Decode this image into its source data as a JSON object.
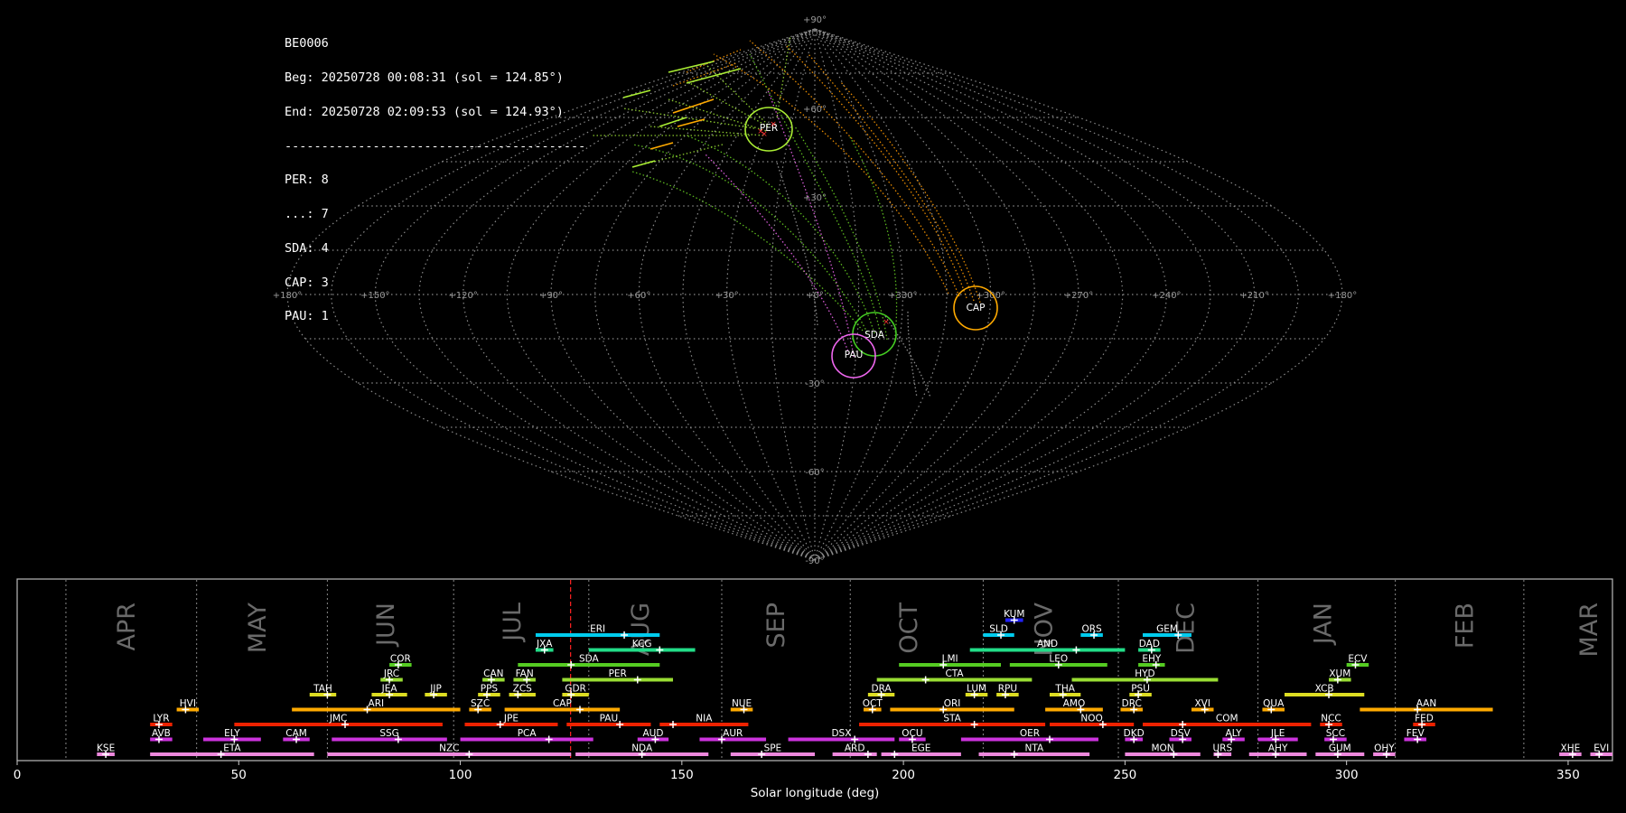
{
  "info": {
    "station": "BE0006",
    "begin": "Beg: 20250728 00:08:31 (sol = 124.85°)",
    "end": "End: 20250728 02:09:53 (sol = 124.93°)",
    "separator": "-----------------------------------------",
    "counts": [
      {
        "label": "PER: 8"
      },
      {
        "label": "...: 7"
      },
      {
        "label": "SDA: 4"
      },
      {
        "label": "CAP: 3"
      },
      {
        "label": "PAU: 1"
      }
    ]
  },
  "sky_map": {
    "lon_labels": [
      "+180°",
      "+150°",
      "+120°",
      "+90°",
      "+60°",
      "+30°",
      "+0°",
      "+330°",
      "+300°",
      "+270°",
      "+240°",
      "+210°",
      "+180°"
    ],
    "lat_labels": [
      "+90°",
      "+60°",
      "+30°",
      "+0°",
      "-30°",
      "-60°",
      "-90°"
    ],
    "showers": [
      {
        "code": "PER",
        "color": "#aaee33"
      },
      {
        "code": "CAP",
        "color": "#ffaa00"
      },
      {
        "code": "SDA",
        "color": "#44cc22"
      },
      {
        "code": "PAU",
        "color": "#ee66ee"
      }
    ]
  },
  "chart_data": {
    "type": "timeline",
    "xlabel": "Solar longitude (deg)",
    "xlim": [
      0,
      360
    ],
    "x_ticks": [
      0,
      50,
      100,
      150,
      200,
      250,
      300,
      350
    ],
    "current_sol": 124.89,
    "month_boundaries": [
      11,
      40.5,
      70,
      98.5,
      129,
      159,
      188,
      218,
      248.5,
      280,
      311,
      340
    ],
    "months": [
      {
        "label": "APR",
        "sol": 25
      },
      {
        "label": "MAY",
        "sol": 54.5
      },
      {
        "label": "JUN",
        "sol": 83.5
      },
      {
        "label": "JUL",
        "sol": 112
      },
      {
        "label": "AUG",
        "sol": 141
      },
      {
        "label": "SEP",
        "sol": 171.5
      },
      {
        "label": "OCT",
        "sol": 201.5
      },
      {
        "label": "NOV",
        "sol": 232
      },
      {
        "label": "DEC",
        "sol": 264
      },
      {
        "label": "JAN",
        "sol": 295
      },
      {
        "label": "FEB",
        "sol": 327
      },
      {
        "label": "MAR",
        "sol": 355
      }
    ],
    "showers": [
      {
        "code": "KUM",
        "start": 223,
        "end": 227,
        "peak": 225,
        "row": 10,
        "color": "#2222ff"
      },
      {
        "code": "ERI",
        "start": 117,
        "end": 145,
        "peak": 137,
        "row": 9,
        "color": "#00ccee"
      },
      {
        "code": "SLD",
        "start": 218,
        "end": 225,
        "peak": 222,
        "row": 9,
        "color": "#00ccee"
      },
      {
        "code": "ORS",
        "start": 240,
        "end": 245,
        "peak": 243,
        "row": 9,
        "color": "#00ccee"
      },
      {
        "code": "GEM",
        "start": 254,
        "end": 265,
        "peak": 262,
        "row": 9,
        "color": "#00ccee"
      },
      {
        "code": "JXA",
        "start": 117,
        "end": 121,
        "peak": 119,
        "row": 8,
        "color": "#22dd88"
      },
      {
        "code": "KCG",
        "start": 129,
        "end": 153,
        "peak": 145,
        "row": 8,
        "color": "#22dd88"
      },
      {
        "code": "AND",
        "start": 215,
        "end": 250,
        "peak": 239,
        "row": 8,
        "color": "#22dd88"
      },
      {
        "code": "DAD",
        "start": 253,
        "end": 258,
        "peak": 256,
        "row": 8,
        "color": "#22dd88"
      },
      {
        "code": "COR",
        "start": 84,
        "end": 89,
        "peak": 86,
        "row": 7,
        "color": "#55cc22"
      },
      {
        "code": "SDA",
        "start": 113,
        "end": 145,
        "peak": 125,
        "row": 7,
        "color": "#55cc22"
      },
      {
        "code": "LMI",
        "start": 199,
        "end": 222,
        "peak": 209,
        "row": 7,
        "color": "#55cc22"
      },
      {
        "code": "LEO",
        "start": 224,
        "end": 246,
        "peak": 235,
        "row": 7,
        "color": "#55cc22"
      },
      {
        "code": "EHY",
        "start": 253,
        "end": 259,
        "peak": 257,
        "row": 7,
        "color": "#55cc22"
      },
      {
        "code": "ECV",
        "start": 300,
        "end": 305,
        "peak": 302,
        "row": 7,
        "color": "#55cc22"
      },
      {
        "code": "JRC",
        "start": 82,
        "end": 87,
        "peak": 84,
        "row": 6,
        "color": "#99dd33"
      },
      {
        "code": "CAN",
        "start": 105,
        "end": 110,
        "peak": 107,
        "row": 6,
        "color": "#99dd33"
      },
      {
        "code": "FAN",
        "start": 112,
        "end": 117,
        "peak": 115,
        "row": 6,
        "color": "#99dd33"
      },
      {
        "code": "PER",
        "start": 123,
        "end": 148,
        "peak": 140,
        "row": 6,
        "color": "#99dd33"
      },
      {
        "code": "CTA",
        "start": 194,
        "end": 229,
        "peak": 205,
        "row": 6,
        "color": "#99dd33"
      },
      {
        "code": "HYD",
        "start": 238,
        "end": 271,
        "peak": 255,
        "row": 6,
        "color": "#99dd33"
      },
      {
        "code": "XUM",
        "start": 296,
        "end": 301,
        "peak": 298,
        "row": 6,
        "color": "#99dd33"
      },
      {
        "code": "TAH",
        "start": 66,
        "end": 72,
        "peak": 70,
        "row": 5,
        "color": "#dddd22"
      },
      {
        "code": "JEA",
        "start": 80,
        "end": 88,
        "peak": 84,
        "row": 5,
        "color": "#dddd22"
      },
      {
        "code": "JIP",
        "start": 92,
        "end": 97,
        "peak": 94,
        "row": 5,
        "color": "#dddd22"
      },
      {
        "code": "PPS",
        "start": 104,
        "end": 109,
        "peak": 106,
        "row": 5,
        "color": "#dddd22"
      },
      {
        "code": "ZCS",
        "start": 111,
        "end": 117,
        "peak": 113,
        "row": 5,
        "color": "#dddd22"
      },
      {
        "code": "GDR",
        "start": 123,
        "end": 129,
        "peak": 125,
        "row": 5,
        "color": "#dddd22"
      },
      {
        "code": "DRA",
        "start": 192,
        "end": 198,
        "peak": 195,
        "row": 5,
        "color": "#dddd22"
      },
      {
        "code": "LUM",
        "start": 214,
        "end": 219,
        "peak": 216,
        "row": 5,
        "color": "#dddd22"
      },
      {
        "code": "RPU",
        "start": 221,
        "end": 226,
        "peak": 223,
        "row": 5,
        "color": "#dddd22"
      },
      {
        "code": "THA",
        "start": 233,
        "end": 240,
        "peak": 236,
        "row": 5,
        "color": "#dddd22"
      },
      {
        "code": "PSU",
        "start": 251,
        "end": 256,
        "peak": 253,
        "row": 5,
        "color": "#dddd22"
      },
      {
        "code": "XCB",
        "start": 286,
        "end": 304,
        "peak": 296,
        "row": 5,
        "color": "#dddd22"
      },
      {
        "code": "HVI",
        "start": 36,
        "end": 41,
        "peak": 38,
        "row": 4,
        "color": "#ffaa00"
      },
      {
        "code": "ARI",
        "start": 62,
        "end": 100,
        "peak": 79,
        "row": 4,
        "color": "#ffaa00"
      },
      {
        "code": "SZC",
        "start": 102,
        "end": 107,
        "peak": 104,
        "row": 4,
        "color": "#ffaa00"
      },
      {
        "code": "CAP",
        "start": 110,
        "end": 136,
        "peak": 127,
        "row": 4,
        "color": "#ffaa00"
      },
      {
        "code": "NUE",
        "start": 161,
        "end": 166,
        "peak": 164,
        "row": 4,
        "color": "#ffaa00"
      },
      {
        "code": "OCT",
        "start": 191,
        "end": 195,
        "peak": 193,
        "row": 4,
        "color": "#ffaa00"
      },
      {
        "code": "ORI",
        "start": 197,
        "end": 225,
        "peak": 209,
        "row": 4,
        "color": "#ffaa00"
      },
      {
        "code": "AMO",
        "start": 232,
        "end": 245,
        "peak": 240,
        "row": 4,
        "color": "#ffaa00"
      },
      {
        "code": "DRC",
        "start": 249,
        "end": 254,
        "peak": 252,
        "row": 4,
        "color": "#ffaa00"
      },
      {
        "code": "XVI",
        "start": 265,
        "end": 270,
        "peak": 268,
        "row": 4,
        "color": "#ffaa00"
      },
      {
        "code": "QUA",
        "start": 281,
        "end": 286,
        "peak": 283,
        "row": 4,
        "color": "#ffaa00"
      },
      {
        "code": "AAN",
        "start": 303,
        "end": 333,
        "peak": 316,
        "row": 4,
        "color": "#ffaa00"
      },
      {
        "code": "LYR",
        "start": 30,
        "end": 35,
        "peak": 32,
        "row": 3,
        "color": "#ee2200"
      },
      {
        "code": "JMC",
        "start": 49,
        "end": 96,
        "peak": 74,
        "row": 3,
        "color": "#ee2200"
      },
      {
        "code": "JPE",
        "start": 101,
        "end": 122,
        "peak": 109,
        "row": 3,
        "color": "#ee2200"
      },
      {
        "code": "PAU",
        "start": 124,
        "end": 143,
        "peak": 136,
        "row": 3,
        "color": "#ee2200"
      },
      {
        "code": "NIA",
        "start": 145,
        "end": 165,
        "peak": 148,
        "row": 3,
        "color": "#ee2200"
      },
      {
        "code": "STA",
        "start": 190,
        "end": 232,
        "peak": 216,
        "row": 3,
        "color": "#ee2200"
      },
      {
        "code": "NOO",
        "start": 233,
        "end": 252,
        "peak": 245,
        "row": 3,
        "color": "#ee2200"
      },
      {
        "code": "COM",
        "start": 254,
        "end": 292,
        "peak": 263,
        "row": 3,
        "color": "#ee2200"
      },
      {
        "code": "NCC",
        "start": 294,
        "end": 299,
        "peak": 296,
        "row": 3,
        "color": "#ee2200"
      },
      {
        "code": "FED",
        "start": 315,
        "end": 320,
        "peak": 317,
        "row": 3,
        "color": "#ee2200"
      },
      {
        "code": "AVB",
        "start": 30,
        "end": 35,
        "peak": 32,
        "row": 2,
        "color": "#cc33dd"
      },
      {
        "code": "ELY",
        "start": 42,
        "end": 55,
        "peak": 49,
        "row": 2,
        "color": "#cc33dd"
      },
      {
        "code": "CAM",
        "start": 60,
        "end": 66,
        "peak": 63,
        "row": 2,
        "color": "#cc33dd"
      },
      {
        "code": "SSG",
        "start": 71,
        "end": 97,
        "peak": 86,
        "row": 2,
        "color": "#cc33dd"
      },
      {
        "code": "PCA",
        "start": 100,
        "end": 130,
        "peak": 120,
        "row": 2,
        "color": "#cc33dd"
      },
      {
        "code": "AUD",
        "start": 140,
        "end": 147,
        "peak": 144,
        "row": 2,
        "color": "#cc33dd"
      },
      {
        "code": "AUR",
        "start": 154,
        "end": 169,
        "peak": 159,
        "row": 2,
        "color": "#cc33dd"
      },
      {
        "code": "DSX",
        "start": 174,
        "end": 198,
        "peak": 189,
        "row": 2,
        "color": "#cc33dd"
      },
      {
        "code": "OCU",
        "start": 199,
        "end": 205,
        "peak": 202,
        "row": 2,
        "color": "#cc33dd"
      },
      {
        "code": "OER",
        "start": 213,
        "end": 244,
        "peak": 233,
        "row": 2,
        "color": "#cc33dd"
      },
      {
        "code": "DKD",
        "start": 250,
        "end": 254,
        "peak": 252,
        "row": 2,
        "color": "#cc33dd"
      },
      {
        "code": "DSV",
        "start": 260,
        "end": 265,
        "peak": 263,
        "row": 2,
        "color": "#cc33dd"
      },
      {
        "code": "ALY",
        "start": 272,
        "end": 277,
        "peak": 274,
        "row": 2,
        "color": "#cc33dd"
      },
      {
        "code": "JLE",
        "start": 280,
        "end": 289,
        "peak": 284,
        "row": 2,
        "color": "#cc33dd"
      },
      {
        "code": "SCC",
        "start": 295,
        "end": 300,
        "peak": 297,
        "row": 2,
        "color": "#cc33dd"
      },
      {
        "code": "FEV",
        "start": 313,
        "end": 318,
        "peak": 316,
        "row": 2,
        "color": "#cc33dd"
      },
      {
        "code": "KSE",
        "start": 18,
        "end": 22,
        "peak": 20,
        "row": 1,
        "color": "#ee88dd"
      },
      {
        "code": "ETA",
        "start": 30,
        "end": 67,
        "peak": 46,
        "row": 1,
        "color": "#ee88dd"
      },
      {
        "code": "NZC",
        "start": 70,
        "end": 125,
        "peak": 102,
        "row": 1,
        "color": "#ee88dd"
      },
      {
        "code": "NDA",
        "start": 126,
        "end": 156,
        "peak": 141,
        "row": 1,
        "color": "#ee88dd"
      },
      {
        "code": "SPE",
        "start": 161,
        "end": 180,
        "peak": 168,
        "row": 1,
        "color": "#ee88dd"
      },
      {
        "code": "ARD",
        "start": 184,
        "end": 194,
        "peak": 192,
        "row": 1,
        "color": "#ee88dd"
      },
      {
        "code": "EGE",
        "start": 195,
        "end": 213,
        "peak": 198,
        "row": 1,
        "color": "#ee88dd"
      },
      {
        "code": "NTA",
        "start": 217,
        "end": 242,
        "peak": 225,
        "row": 1,
        "color": "#ee88dd"
      },
      {
        "code": "MON",
        "start": 250,
        "end": 267,
        "peak": 261,
        "row": 1,
        "color": "#ee88dd"
      },
      {
        "code": "URS",
        "start": 270,
        "end": 274,
        "peak": 271,
        "row": 1,
        "color": "#ee88dd"
      },
      {
        "code": "AHY",
        "start": 278,
        "end": 291,
        "peak": 284,
        "row": 1,
        "color": "#ee88dd"
      },
      {
        "code": "GUM",
        "start": 293,
        "end": 304,
        "peak": 298,
        "row": 1,
        "color": "#ee88dd"
      },
      {
        "code": "OHY",
        "start": 306,
        "end": 311,
        "peak": 309,
        "row": 1,
        "color": "#ee88dd"
      },
      {
        "code": "XHE",
        "start": 348,
        "end": 353,
        "peak": 351,
        "row": 1,
        "color": "#ee88dd"
      },
      {
        "code": "EVI",
        "start": 355,
        "end": 360,
        "peak": 357,
        "row": 1,
        "color": "#ee88dd"
      }
    ]
  }
}
